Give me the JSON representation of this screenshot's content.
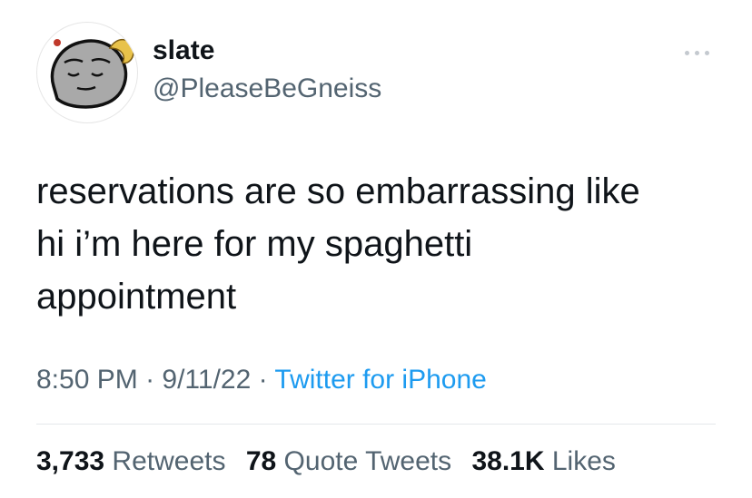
{
  "author": {
    "display_name": "slate",
    "handle": "@PleaseBeGneiss"
  },
  "avatar": {
    "icon": "rock-face-avatar"
  },
  "more_icon": "more-icon",
  "tweet": {
    "text": "reservations are so embarrassing like\nhi i’m here for my spaghetti\nappointment"
  },
  "meta": {
    "time": "8:50 PM",
    "date": "9/11/22",
    "source": "Twitter for iPhone",
    "separator": " · "
  },
  "stats": {
    "retweets": {
      "count": "3,733",
      "label": "Retweets"
    },
    "quotes": {
      "count": "78",
      "label": "Quote Tweets"
    },
    "likes": {
      "count": "38.1K",
      "label": "Likes"
    }
  },
  "colors": {
    "text": "#0f1419",
    "secondary": "#536471",
    "link": "#1d9bf0",
    "divider": "#e5e8eb"
  }
}
